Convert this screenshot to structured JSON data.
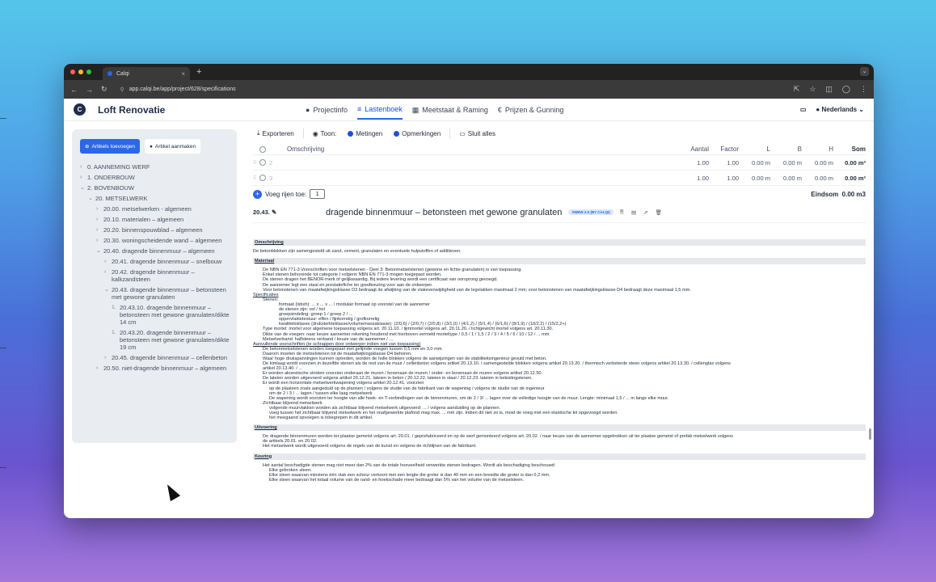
{
  "browser": {
    "tab_title": "Calqi",
    "url": "app.calqi.be/app/project/628/specifications"
  },
  "header": {
    "project_title": "Loft Renovatie",
    "nav": [
      "Projectinfo",
      "Lastenboek",
      "Meetstaat & Raming",
      "Prijzen & Gunning"
    ],
    "language": "Nederlands"
  },
  "sidebar": {
    "add_articles": "Artikels toevoegen",
    "create_article": "Artikel aanmaken",
    "tree": [
      {
        "label": "0. AANNEMING WERF",
        "level": 0,
        "chev": "›"
      },
      {
        "label": "1. ONDERBOUW",
        "level": 0,
        "chev": "›"
      },
      {
        "label": "2. BOVENBOUW",
        "level": 0,
        "chev": "⌄"
      },
      {
        "label": "20. METSELWERK",
        "level": 1,
        "chev": "⌄"
      },
      {
        "label": "20.00. metselwerken - algemeen",
        "level": 2,
        "chev": "›"
      },
      {
        "label": "20.10. materialen – algemeen",
        "level": 2,
        "chev": "›"
      },
      {
        "label": "20.20. binnenspouwblad – algemeen",
        "level": 2,
        "chev": "›"
      },
      {
        "label": "20.30. woningscheidende wand – algemeen",
        "level": 2,
        "chev": "›"
      },
      {
        "label": "20.40. dragende binnenmuur – algemeen",
        "level": 2,
        "chev": "⌄"
      },
      {
        "label": "20.41. dragende binnenmuur – snelbouw",
        "level": 3,
        "chev": "›"
      },
      {
        "label": "20.42. dragende binnenmuur – kalkzandsteen",
        "level": 3,
        "chev": "›"
      },
      {
        "label": "20.43. dragende binnenmuur – betonsteen met gewone granulaten",
        "level": 3,
        "chev": "⌄"
      },
      {
        "label": "20.43.10. dragende binnenmuur – betonsteen met gewone granulaten/dikte 14 cm",
        "level": 4,
        "chev": "L"
      },
      {
        "label": "20.43.20. dragende binnenmuur – betonsteen met gewone granulaten/dikte 19 cm",
        "level": 4,
        "chev": "L"
      },
      {
        "label": "20.45. dragende binnenmuur – cellenbeton",
        "level": 3,
        "chev": "›"
      },
      {
        "label": "20.50. niet-dragende binnenmuur – algemeen",
        "level": 2,
        "chev": "›"
      }
    ]
  },
  "toolbar": {
    "export": "Exporteren",
    "show": "Toon:",
    "measurements": "Metingen",
    "remarks": "Opmerkingen",
    "close_all": "Sluit alles"
  },
  "table": {
    "headers": {
      "desc": "Omschrijving",
      "aantal": "Aantal",
      "factor": "Factor",
      "l": "L",
      "b": "B",
      "h": "H",
      "som": "Som"
    },
    "rows": [
      {
        "idx": "2",
        "aantal": "1.00",
        "factor": "1.00",
        "l": "0.00",
        "b": "0.00",
        "h": "0.00",
        "lu": "m",
        "bu": "m",
        "hu": "m",
        "som": "0.00 m³"
      },
      {
        "idx": "3",
        "aantal": "1.00",
        "factor": "1.00",
        "l": "0.00",
        "b": "0.00",
        "h": "0.00",
        "lu": "m",
        "bu": "m",
        "hu": "m",
        "som": "0.00 m³"
      }
    ],
    "add_rows_label": "Voeg rijen toe:",
    "add_rows_value": "1",
    "total_label": "Eindsom",
    "total_value": "0.00 m3"
  },
  "article": {
    "code": "20.43.",
    "title": "dragende binnenmuur – betonsteen met gewone granulaten",
    "badge": "VMBW 2.0 (BY CALQI)"
  },
  "spec": [
    {
      "t": "h",
      "text": "Omschrijving"
    },
    {
      "t": "p",
      "c": "",
      "text": "De betonblokken zijn samengesteld uit zand, cement, granulaten en eventuele hulpstoffen of additieven."
    },
    {
      "t": "h",
      "text": "Materiaal"
    },
    {
      "t": "p",
      "c": "i1",
      "text": "De NBN EN 771-3 Voorschriften voor metselstenen - Deel 3: Betonmetselstenen (gewone en lichte granulaten) is van toepassing."
    },
    {
      "t": "p",
      "c": "i1",
      "text": "Enkel stenen behorende tot categorie I volgens NBN EN 771-3 mogen toegepast worden."
    },
    {
      "t": "p",
      "c": "i1",
      "text": "De stenen dragen het BENOR-merk of gelijkwaardig. Bij iedere levering wordt een certificaat van oorsprong gevoegd."
    },
    {
      "t": "p",
      "c": "i1",
      "text": "De aannemer legt een staal en prestatiefiche ter goedkeuring voor aan de ontwerper."
    },
    {
      "t": "p",
      "c": "i1",
      "text": "Voor betonstenen van maatafwijkingsklasse D3 bedraagt de afwijking van de vlakevenwijdigheid van de legvlakken maximaal 2 mm; voor betonstenen van maatafwijkingsklasse D4 bedraagt deze maximaal 1,5 mm."
    },
    {
      "t": "u",
      "c": "",
      "text": "Specificaties"
    },
    {
      "t": "p",
      "c": "i1",
      "text": "Stenen:"
    },
    {
      "t": "p",
      "c": "i3",
      "text": "formaat (lxbxh): ... x ... x ... / modulair formaat op voorstel van de aannemer"
    },
    {
      "t": "p",
      "c": "i3",
      "text": "de stenen zijn: vol / hol"
    },
    {
      "t": "p",
      "c": "i3",
      "text": "groepsindeling: groep 1 / groep 2 / ..."
    },
    {
      "t": "p",
      "c": "i3",
      "text": "oppervlaktetextuur: effen / fijnkorrelig / grofkorrelig"
    },
    {
      "t": "p",
      "c": "i3",
      "text": "kwaliteitsklasse (druksterkteklasse/volumemassaklasse): (2/0,6) / (2/0,7) / (2/0,8) / (3/1,0) / (4/1,2) / (5/1,4) / (6/1,6) / (8/1,9) / (10/2,2) / (15/2,2+)"
    },
    {
      "t": "p",
      "c": "i1",
      "text": "Type mortel: mortel voor algemene toepassing volgens art. 20.11.10. / lijmmortel volgens art. 20.11.20. / lichtgewicht mortel volgens art. 20.11.30."
    },
    {
      "t": "p",
      "c": "i1",
      "text": "Dikte van de voegen: naar keuze aannemer rekening houdend met hierboven vermeld morteltype / 0,5 / 1 / 1,5 / 2 / 3 / 4 / 5 / 6 / 10 / 12 / ... mm"
    },
    {
      "t": "p",
      "c": "i1",
      "text": "Metselverband: halfsteens verband / keuze van de aannemer / ..."
    },
    {
      "t": "u",
      "c": "",
      "text": "Aanvullende voorschriften (te schrappen door ontwerper indien niet van toepassing)"
    },
    {
      "t": "p",
      "c": "i1",
      "text": "De betonmetselstenen worden toegepast met gelijmde voegen tussen 0,5 mm en 3,0 mm."
    },
    {
      "t": "p",
      "c": "i1",
      "text": "Daarom moeten de metselstenen tot de maatafwijkingsklasse D4 behoren."
    },
    {
      "t": "p",
      "c": "i1",
      "text": "Waar hoge drukspanningen kunnen optreden, worden de holle blokken volgens de aanwijzingen van de stabiliteitsingenieur gevuld met beton."
    },
    {
      "t": "p",
      "c": "i1",
      "text": "De kimlaag wordt voorzien in dezelfde stenen als de rest van de muur / cellenbeton volgens artikel 20.13.10. / samengestelde blokken volgens artikel 20.13.20. / thermisch verbeterde steen volgens artikel 20.13.30. / cellenglas volgens"
    },
    {
      "t": "p",
      "c": "i1",
      "text": "artikel 20.13.40. / ..."
    },
    {
      "t": "p",
      "c": "i1",
      "text": "Er worden akoestische stroken voorzien onderaan de muren / bovenaan de muren / onder- en bovenaan de muren volgens artikel 20.12.50."
    },
    {
      "t": "p",
      "c": "i1",
      "text": "De latei­en worden uitgevoerd volgens artikel 20.12.21. lateien in beton / 20.12.22. lateien in staal / 20.12.23. lateien in bekistingstenen."
    },
    {
      "t": "p",
      "c": "i1",
      "text": "Er wordt een horizontale metselwerkwapening volgens artikel 20.12.41. voorzien"
    },
    {
      "t": "p",
      "c": "i2",
      "text": "op de plaatsen zoals aangeduid op de plannen / volgens de studie van de fabrikant van de wapening / volgens de studie van de ingenieur"
    },
    {
      "t": "p",
      "c": "i2",
      "text": "om de 2 / 3 / ... lagen / tussen elke laag metselwerk"
    },
    {
      "t": "p",
      "c": "i2",
      "text": "De wapening wordt voorzien ter hoogte van alle hoek- en T-verbindingen van de binnenmuren, om de 2 / 3/ ... lagen over de volledige hoogte van de muur. Lengte: minimaal 1,5 / ... m langs elke muur."
    },
    {
      "t": "p",
      "c": "i1",
      "text": "Zichtbaar blijvend metselwerk"
    },
    {
      "t": "p",
      "c": "i2",
      "text": "volgende muurvlakken worden als zichtbaar blijvend metselwerk uitgevoerd: ... / volgens aanduiding op de plannen."
    },
    {
      "t": "p",
      "c": "i2",
      "text": "voeg tussen het zichtbaar blijvend metselwerk en het onafgewerkte plafond mag max. ... mm zijn. Indien dit niet zo is, moet de voeg met een elastische kit opgevoegd worden."
    },
    {
      "t": "p",
      "c": "i2",
      "text": "het meegaand opvoegen is inbegrepen in dit artikel."
    },
    {
      "t": "h",
      "text": "Uitvoering"
    },
    {
      "t": "p",
      "c": "i1",
      "text": "De dragende binnenmuren worden ter plaatse gemetst volgens art. 20.01. / geprefabriceerd en op de werf gemonteerd volgens art. 20.02. / naar keuze van de aannemer opgetrokken uit ter plaatse gemetst of prefab metselwerk volgens"
    },
    {
      "t": "p",
      "c": "i1",
      "text": "de artikels 20.01. en 20.02."
    },
    {
      "t": "p",
      "c": "i1",
      "text": "Het metselwerk wordt uitgevoerd volgens de regels van de kunst en volgens de richtlijnen van de fabrikant."
    },
    {
      "t": "h",
      "text": "Keuring"
    },
    {
      "t": "p",
      "c": "i1",
      "text": "Het aantal beschadigde stenen mag niet meer dan 2% van de totale hoeveelheid verwerkte stenen bedragen. Wordt als beschadiging beschouwd:"
    },
    {
      "t": "p",
      "c": "i2",
      "text": "Elke gebroken steen."
    },
    {
      "t": "p",
      "c": "i2",
      "text": "Elke steen waarvan minstens één vlak een scheur vertoont met een lengte die groter is dan 40 mm en een breedte die groter is dan 0,2 mm."
    },
    {
      "t": "p",
      "c": "i2",
      "text": "Elke steen waarvan het totaal volume van de rand- en hoekschade meer bedraagt dan 5% van het volume van de metselsteen."
    }
  ]
}
